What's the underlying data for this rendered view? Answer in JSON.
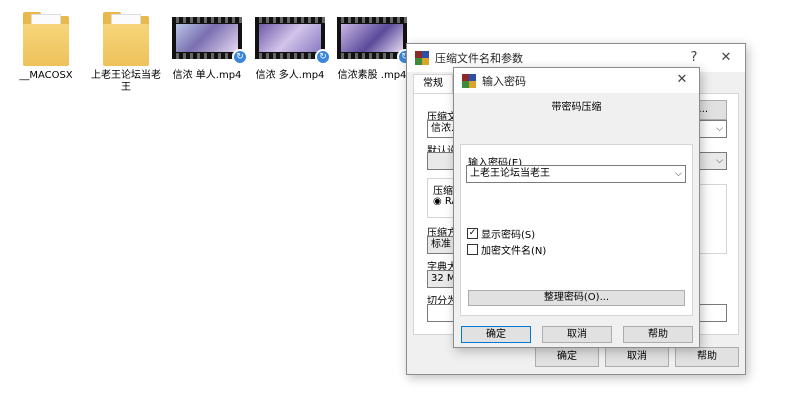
{
  "desktop": {
    "icons": [
      {
        "label": "__MACOSX"
      },
      {
        "label": "上老王论坛当老王"
      },
      {
        "label": "信浓 单人.mp4"
      },
      {
        "label": "信浓 多人.mp4"
      },
      {
        "label": "信浓素股 .mp4"
      }
    ]
  },
  "archive_dialog": {
    "title": "压缩文件名和参数",
    "help_glyph": "?",
    "close_glyph": "✕",
    "tab_general": "常规",
    "archive_label_partial": "压缩文",
    "archive_value_partial": "信浓.r",
    "browse_partial": "(B)...",
    "profile_label_partial": "默认设",
    "format_group_partial": "压缩文",
    "format_rar_partial": "RA",
    "method_label_partial": "压缩方",
    "method_value": "标准",
    "dict_label_partial": "字典大",
    "dict_value": "32 MB",
    "split_label_partial": "切分为",
    "ok": "确定",
    "cancel": "取消",
    "help": "帮助"
  },
  "password_dialog": {
    "title": "输入密码",
    "close_glyph": "✕",
    "heading": "带密码压缩",
    "enter_label": "输入密码(E)",
    "password_value": "上老王论坛当老王",
    "show_password": "显示密码(S)",
    "show_password_checked": true,
    "encrypt_names": "加密文件名(N)",
    "encrypt_names_checked": false,
    "organize": "整理密码(O)...",
    "ok": "确定",
    "cancel": "取消",
    "help": "帮助"
  }
}
